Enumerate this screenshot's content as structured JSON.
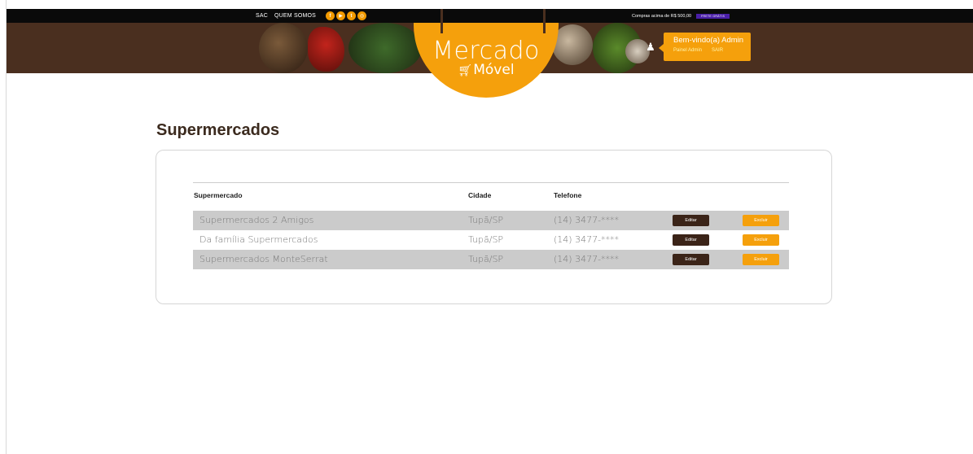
{
  "topbar": {
    "links": [
      "SAC",
      "QUEM SOMOS"
    ],
    "socials": [
      {
        "icon": "facebook-icon",
        "glyph": "f",
        "color": "#f29a00"
      },
      {
        "icon": "youtube-icon",
        "glyph": "▶",
        "color": "#f29a00"
      },
      {
        "icon": "twitter-icon",
        "glyph": "t",
        "color": "#f29a00"
      },
      {
        "icon": "instagram-icon",
        "glyph": "◎",
        "color": "#f29a00"
      }
    ],
    "promo_text": "Compras acima de R$ 500,00",
    "promo_badge": "FRETE GRÁTIS"
  },
  "logo": {
    "title": "Mercado",
    "subtitle": "Móvel"
  },
  "user": {
    "welcome": "Bem-vindo(a) Admin",
    "panel_link": "Painel Admin",
    "logout_link": "SAIR"
  },
  "page": {
    "title": "Supermercados"
  },
  "table": {
    "headers": {
      "name": "Supermercado",
      "city": "Cidade",
      "phone": "Telefone"
    },
    "rows": [
      {
        "name": "Supermercados 2 Amigos",
        "city": "Tupã/SP",
        "phone": "(14) 3477-****",
        "edit": "Editar",
        "delete": "Excluir"
      },
      {
        "name": "Da família Supermercados",
        "city": "Tupã/SP",
        "phone": "(14) 3477-****",
        "edit": "Editar",
        "delete": "Excluir"
      },
      {
        "name": "Supermercados MonteSerrat",
        "city": "Tupã/SP",
        "phone": "(14) 3477-****",
        "edit": "Editar",
        "delete": "Excluir"
      }
    ]
  },
  "colors": {
    "accent": "#f5a00c",
    "brown": "#3b2418",
    "topbar": "#0a0a0a",
    "row_alt": "#cbcbcb"
  }
}
